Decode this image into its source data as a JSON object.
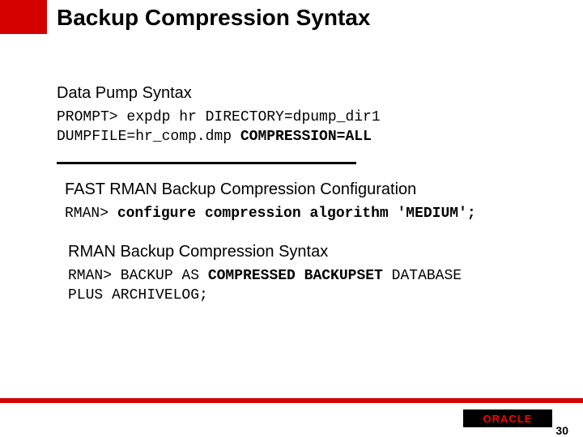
{
  "slide": {
    "title": "Backup Compression Syntax",
    "section1": {
      "heading": "Data Pump Syntax",
      "code_line1_a": "PROMPT> expdp hr DIRECTORY=dpump_dir1",
      "code_line2_a": "       DUMPFILE=hr_comp.dmp ",
      "code_line2_b": "COMPRESSION=ALL"
    },
    "section2": {
      "heading": "FAST RMAN Backup Compression Configuration",
      "code_a": "RMAN> ",
      "code_b": "configure compression algorithm 'MEDIUM';"
    },
    "section3": {
      "heading": "RMAN Backup Compression Syntax",
      "code_line1_a": "RMAN> BACKUP AS ",
      "code_line1_b": "COMPRESSED BACKUPSET",
      "code_line1_c": " DATABASE",
      "code_line2": "      PLUS ARCHIVELOG;"
    },
    "logo_text": "ORACLE",
    "page_number": "30"
  }
}
